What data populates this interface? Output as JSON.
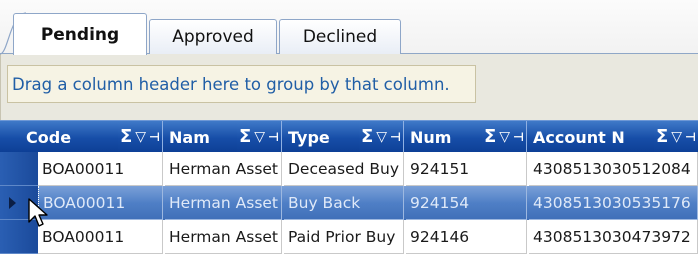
{
  "tabs": [
    {
      "label": "Pending",
      "active": true
    },
    {
      "label": "Approved",
      "active": false
    },
    {
      "label": "Declined",
      "active": false
    }
  ],
  "group_panel": {
    "hint": "Drag a column header here to group by that column."
  },
  "columns": [
    {
      "label": "Code"
    },
    {
      "label": "Nam"
    },
    {
      "label": "Type"
    },
    {
      "label": "Num"
    },
    {
      "label": "Account N"
    }
  ],
  "header_icons": {
    "sum": "Σ",
    "filter": "▽",
    "pin": "⊣"
  },
  "rows": [
    {
      "code": "BOA00011",
      "name": "Herman Asset",
      "type": "Deceased Buy",
      "num": "924151",
      "account": "4308513030512084",
      "selected": false
    },
    {
      "code": "BOA00011",
      "name": "Herman Asset",
      "type": "Buy Back",
      "num": "924154",
      "account": "4308513030535176",
      "selected": true
    },
    {
      "code": "BOA00011",
      "name": "Herman Asset",
      "type": "Paid Prior Buy",
      "num": "924146",
      "account": "4308513030473972",
      "selected": false
    }
  ],
  "colors": {
    "header_blue": "#174ea8",
    "selected_row": "#4f7fc6",
    "group_hint_text": "#205ea6"
  },
  "icons": {
    "row_pointer": "triangle-right-icon",
    "cursor": "mouse-pointer-icon"
  }
}
